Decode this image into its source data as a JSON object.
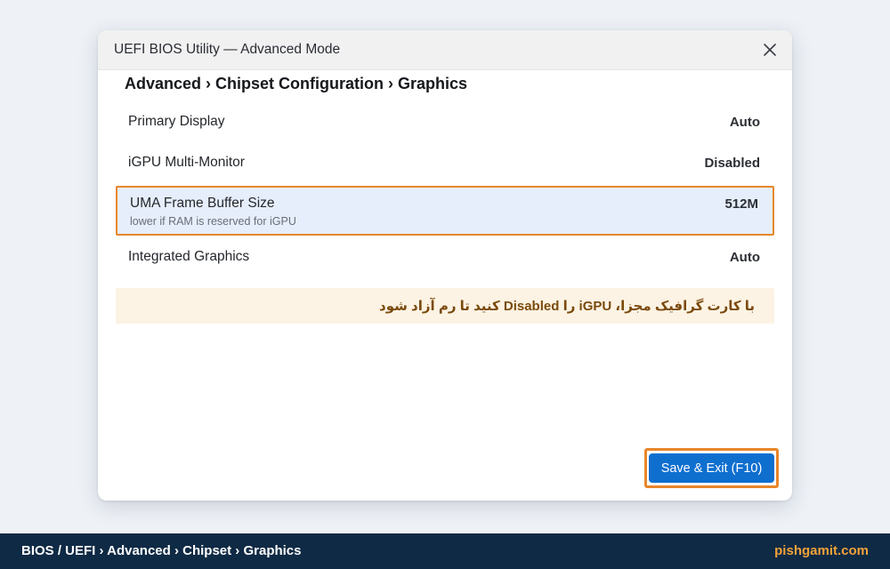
{
  "window": {
    "title": "UEFI BIOS Utility — Advanced Mode",
    "close_icon": "close-icon"
  },
  "breadcrumb": "Advanced › Chipset Configuration › Graphics",
  "settings": [
    {
      "label": "Primary Display",
      "value": "Auto"
    },
    {
      "label": "iGPU Multi-Monitor",
      "value": "Disabled"
    },
    {
      "label": "UMA Frame Buffer Size",
      "value": "512M",
      "hint": "lower if RAM is reserved for iGPU",
      "selected": true
    },
    {
      "label": "Integrated Graphics",
      "value": "Auto"
    }
  ],
  "notice": "با کارت گرافیک مجزا، iGPU را Disabled کنید تا رم آزاد شود",
  "save_button": "Save & Exit (F10)",
  "footer": {
    "path": "BIOS / UEFI › Advanced › Chipset › Graphics",
    "brand": "pishgamit.com"
  },
  "colors": {
    "accent": "#0f6fcf",
    "highlight_border": "#e8862a",
    "selected_row_bg": "#e6eefb",
    "notice_bg": "#fdf3e4",
    "footer_bg": "#0f2a45",
    "brand": "#f2a33a"
  }
}
